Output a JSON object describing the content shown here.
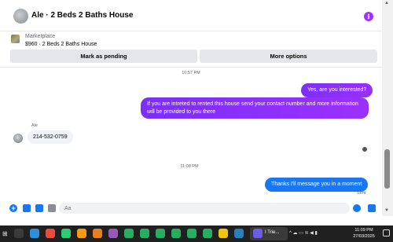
{
  "header": {
    "title": "Ale · 2 Beds 2 Baths House",
    "info_icon": "i"
  },
  "listing": {
    "section_label": "Marketplace",
    "item_text": "$960 · 2 Beds 2 Baths House"
  },
  "actions": {
    "pending_label": "Mark as pending",
    "more_label": "More options"
  },
  "chat": {
    "timestamp_1": "10:57 PM",
    "msg_out_1": "Yes, are you interested?",
    "msg_out_2": "If you are intreted to rented this house send your contact number and more information will be provided to you there",
    "sender_name": "Ale",
    "msg_in_1": "214-532-0759",
    "timestamp_2": "11:08 PM",
    "msg_out_3": "Thanks I'll message you in a moment",
    "status": "Sent"
  },
  "composer": {
    "placeholder": "Aa"
  },
  "taskbar": {
    "active_label": "I Trie...",
    "time": "11:09 PM",
    "date": "27/03/2025"
  },
  "colors": {
    "accent_purple": "#8a2be2",
    "accent_blue": "#1877f2",
    "bubble_in": "#f0f2f5",
    "taskbar": "#202020"
  },
  "icons": [
    "info-icon",
    "plus-icon",
    "photo-icon",
    "sticker-icon",
    "gif-icon",
    "emoji-icon",
    "like-icon",
    "windows-icon"
  ]
}
